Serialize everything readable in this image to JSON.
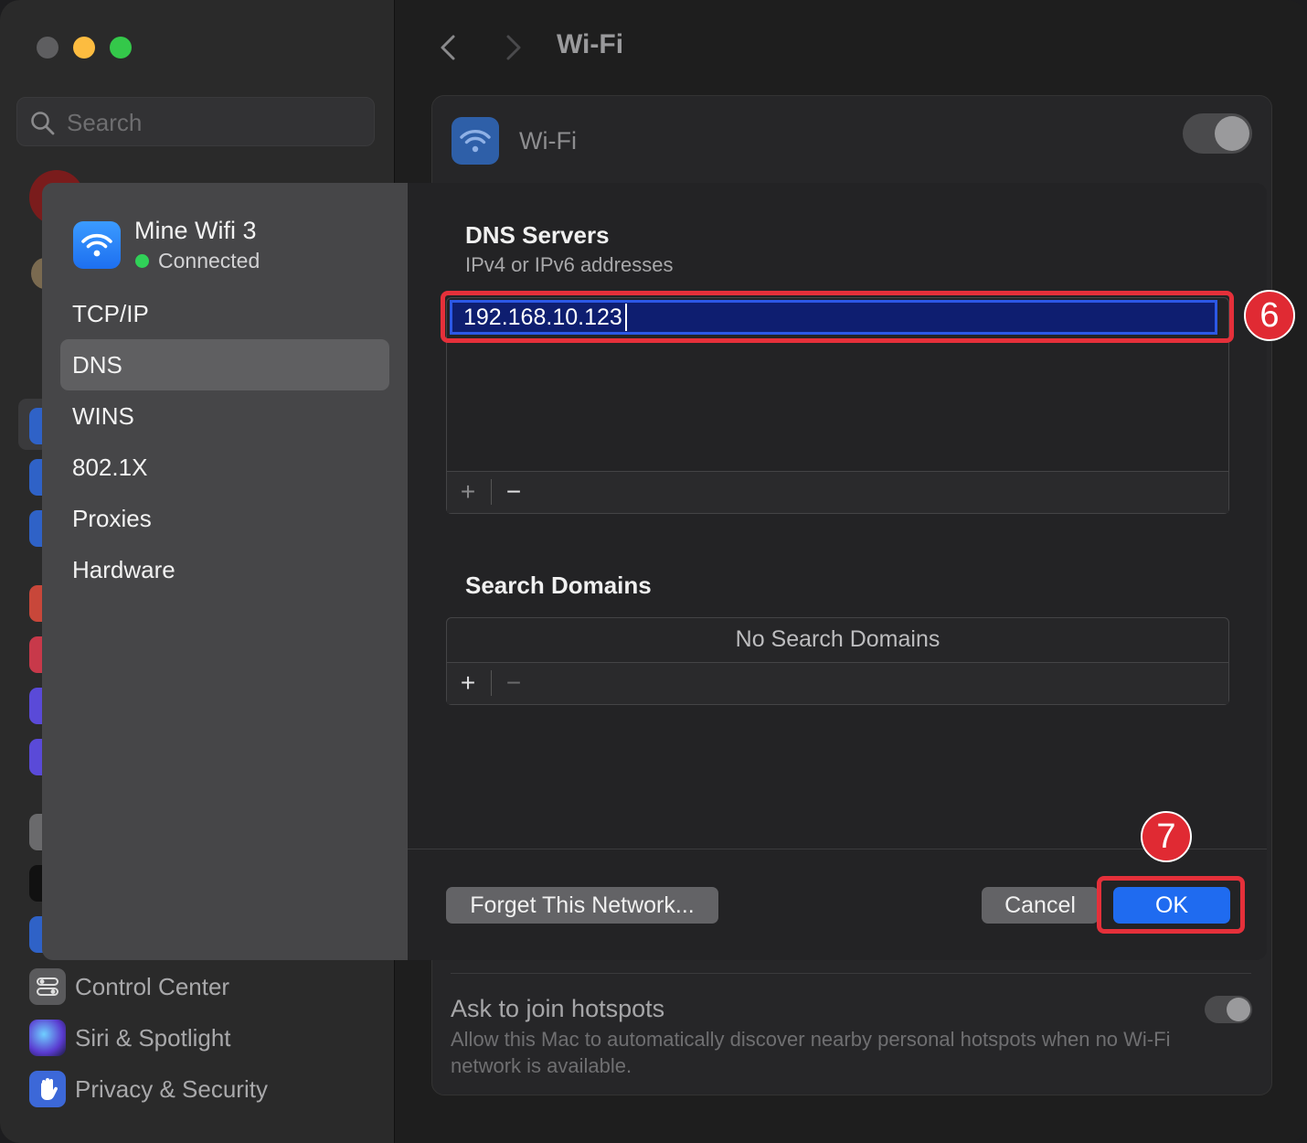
{
  "window": {
    "title": "Wi-Fi"
  },
  "sidebar": {
    "search_placeholder": "Search",
    "bottom_items": [
      {
        "label": "Control Center",
        "icon": "control-center-icon",
        "color": "#5a5a5c"
      },
      {
        "label": "Siri & Spotlight",
        "icon": "siri-icon",
        "color": "#3a3a6a"
      },
      {
        "label": "Privacy & Security",
        "icon": "hand-icon",
        "color": "#3c68d8"
      }
    ]
  },
  "main": {
    "wifi_label": "Wi-Fi",
    "hotspot": {
      "title": "Ask to join hotspots",
      "description": "Allow this Mac to automatically discover nearby personal hotspots when no Wi-Fi network is available."
    }
  },
  "sheet": {
    "network": {
      "name": "Mine Wifi 3",
      "status": "Connected"
    },
    "tabs": [
      {
        "label": "TCP/IP"
      },
      {
        "label": "DNS"
      },
      {
        "label": "WINS"
      },
      {
        "label": "802.1X"
      },
      {
        "label": "Proxies"
      },
      {
        "label": "Hardware"
      }
    ],
    "active_tab": "DNS",
    "dns": {
      "title": "DNS Servers",
      "subtitle": "IPv4 or IPv6 addresses",
      "entries": [
        "192.168.10.123"
      ],
      "add_label": "+",
      "remove_label": "−"
    },
    "search_domains": {
      "title": "Search Domains",
      "empty_message": "No Search Domains",
      "add_label": "+",
      "remove_label": "−"
    },
    "buttons": {
      "forget": "Forget This Network...",
      "cancel": "Cancel",
      "ok": "OK"
    }
  },
  "annotations": {
    "step_6": "6",
    "step_7": "7"
  },
  "colors": {
    "accent": "#1f6bf0",
    "highlight": "#e5303a",
    "connected": "#30d158"
  }
}
